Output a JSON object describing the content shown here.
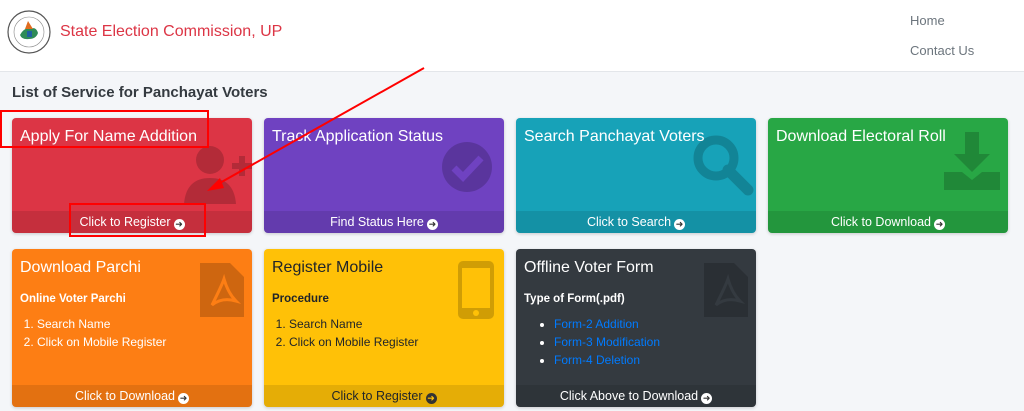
{
  "header": {
    "brand": "State Election Commission, UP",
    "nav": [
      "Home",
      "Contact Us"
    ]
  },
  "page_title": "List of Service for Panchayat Voters",
  "cards": {
    "name_addition": {
      "title": "Apply For Name Addition",
      "footer": "Click to Register",
      "icon": "user-plus-icon",
      "color": "#dc3545"
    },
    "track_status": {
      "title": "Track Application Status",
      "footer": "Find Status Here",
      "icon": "check-circle-icon",
      "color": "#6f42c1"
    },
    "search_voters": {
      "title": "Search Panchayat Voters",
      "footer": "Click to Search",
      "icon": "search-icon",
      "color": "#17a2b8"
    },
    "electoral_roll": {
      "title": "Download Electoral Roll",
      "footer": "Click to Download",
      "icon": "download-icon",
      "color": "#28a745"
    },
    "parchi": {
      "title": "Download Parchi",
      "subtitle": "Online Voter Parchi",
      "steps": [
        "Search Name",
        "Click on Mobile Register"
      ],
      "footer": "Click to Download",
      "icon": "pdf-file-icon",
      "color": "#fd7e14"
    },
    "register_mobile": {
      "title": "Register Mobile",
      "subtitle": "Procedure",
      "steps": [
        "Search Name",
        "Click on Mobile Register"
      ],
      "footer": "Click to Register",
      "icon": "mobile-phone-icon",
      "color": "#ffc107"
    },
    "offline_form": {
      "title": "Offline Voter Form",
      "subtitle": "Type of Form(.pdf)",
      "forms": [
        "Form-2 Addition",
        "Form-3 Modification",
        "Form-4 Deletion"
      ],
      "footer": "Click Above to Download",
      "icon": "pdf-file-icon",
      "color": "#343a40"
    }
  },
  "annotation_color": "#ff0000"
}
